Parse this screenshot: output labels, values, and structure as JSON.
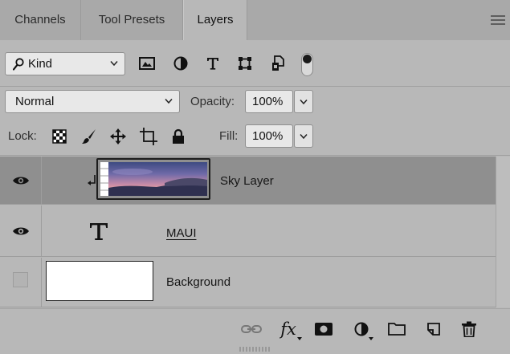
{
  "tabs": [
    {
      "label": "Channels",
      "active": false
    },
    {
      "label": "Tool Presets",
      "active": false
    },
    {
      "label": "Layers",
      "active": true
    }
  ],
  "filter": {
    "kind_label": "Kind",
    "icons": [
      "image-filter-icon",
      "adjustment-filter-icon",
      "type-filter-icon",
      "shape-filter-icon",
      "smart-object-filter-icon"
    ],
    "toggle_on": true
  },
  "blend": {
    "mode": "Normal",
    "opacity_label": "Opacity:",
    "opacity_value": "100%"
  },
  "lock": {
    "label": "Lock:",
    "icons": [
      "lock-transparent-icon",
      "lock-image-icon",
      "lock-position-icon",
      "lock-artboard-icon",
      "lock-all-icon"
    ],
    "fill_label": "Fill:",
    "fill_value": "100%"
  },
  "layers": [
    {
      "name": "Sky Layer",
      "visible": true,
      "selected": true,
      "clipped": true
    },
    {
      "name": "MAUI",
      "visible": true,
      "selected": false,
      "type": "text"
    },
    {
      "name": "Background",
      "visible": false,
      "selected": false
    }
  ],
  "colors": {
    "panel_bg": "#b8b8b8",
    "selected_row": "#8f8f8f",
    "tab_bg": "#a9a9a9"
  },
  "bottom_icons": [
    "link-layers-icon",
    "fx-icon",
    "add-mask-icon",
    "adjustment-layer-icon",
    "group-folder-icon",
    "new-layer-icon",
    "trash-icon"
  ],
  "fx_label": "fx"
}
